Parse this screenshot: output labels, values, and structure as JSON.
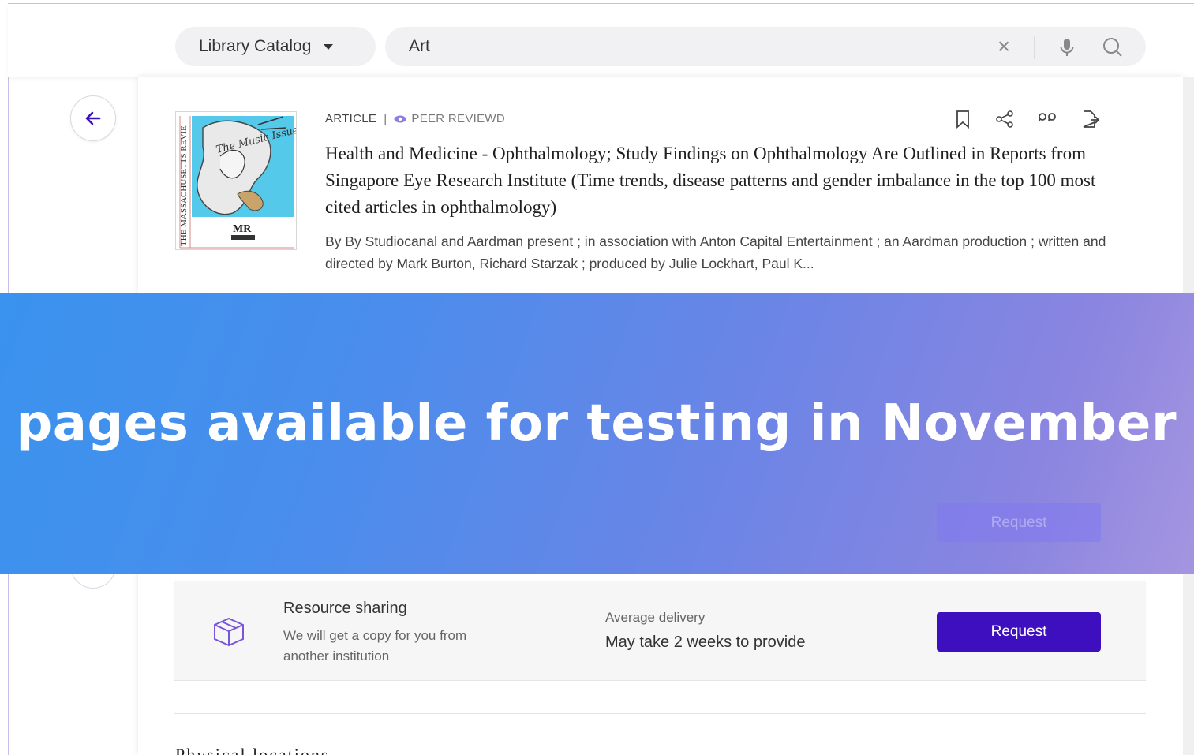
{
  "header": {
    "scope_label": "Library Catalog",
    "search_value": "Art"
  },
  "record": {
    "type": "ARTICLE",
    "badge": "PEER REVIEWD",
    "title": "Health and Medicine - Ophthalmology; Study Findings on Ophthalmology Are Outlined in Reports from Singapore Eye Research Institute (Time trends, disease patterns and gender imbalance in the top 100 most cited articles in ophthalmology)",
    "authors": "By By Studiocanal and Aardman present ; in association with Anton Capital Entertainment ; an Aardman production ; written and directed by Mark Burton, Richard Starzak ; produced by Julie Lockhart, Paul K...",
    "cover": {
      "spine": "THE MASSACHUSETTS REVIE",
      "script": "The Music Issue",
      "logo": "MR"
    }
  },
  "banner": {
    "text": "t pages available for testing in November",
    "ghost_button": "Request"
  },
  "resource_sharing": {
    "title": "Resource sharing",
    "description": "We will get a copy for you from another institution",
    "delivery_label": "Average delivery",
    "delivery_value": "May take 2 weeks to provide",
    "button": "Request"
  },
  "section": {
    "physical_heading": "Physical locations"
  },
  "colors": {
    "primary": "#3d0fbf",
    "accent": "#8a7ee0",
    "banner_start": "#3a93ee",
    "banner_end": "#a595e0"
  },
  "icons": [
    "chevron-down-icon",
    "close-icon",
    "microphone-icon",
    "search-icon",
    "arrow-left-icon",
    "eye-icon",
    "bookmark-icon",
    "share-icon",
    "quote-icon",
    "export-icon",
    "package-icon"
  ]
}
